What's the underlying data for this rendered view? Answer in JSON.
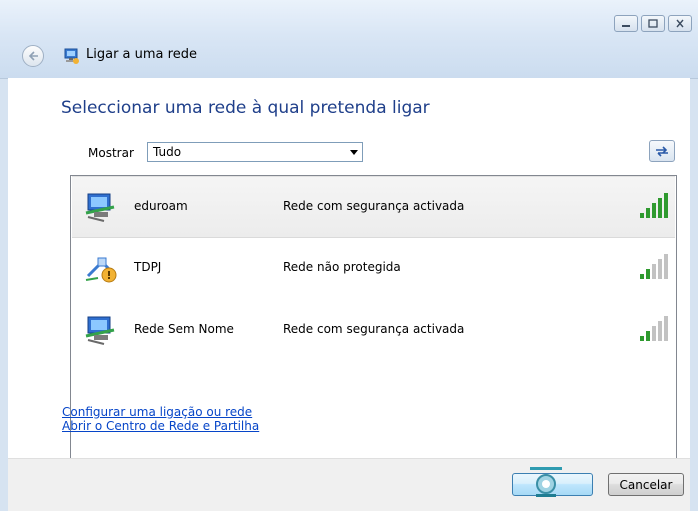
{
  "window": {
    "title": "Ligar a uma rede",
    "icons": {
      "back": "back-arrow-icon",
      "app": "network-icon",
      "minimize": "minimize-icon",
      "maximize": "maximize-icon",
      "close": "close-icon"
    }
  },
  "main": {
    "heading": "Seleccionar uma rede à qual pretenda ligar",
    "show_label": "Mostrar",
    "filter_value": "Tudo",
    "refresh_icon": "refresh-icon"
  },
  "networks": [
    {
      "name": "eduroam",
      "status": "Rede com segurança activada",
      "icon": "secure-wireless-icon",
      "signal_bars": 5,
      "selected": true
    },
    {
      "name": "TDPJ",
      "status": "Rede não protegida",
      "icon": "unsecured-wireless-icon",
      "signal_bars": 2,
      "selected": false
    },
    {
      "name": "Rede Sem Nome",
      "status": "Rede com segurança activada",
      "icon": "secure-wireless-icon",
      "signal_bars": 2,
      "selected": false
    }
  ],
  "links": {
    "setup": "Configurar uma ligação ou rede",
    "network_center": "Abrir o Centro de Rede e Partilha"
  },
  "footer": {
    "connect_icon": "busy-spinner-icon",
    "cancel_label": "Cancelar"
  },
  "colors": {
    "signal_active": "#2f9a2f",
    "signal_inactive": "#b8b8b8",
    "heading": "#1f3f8a",
    "link": "#0645c8"
  }
}
